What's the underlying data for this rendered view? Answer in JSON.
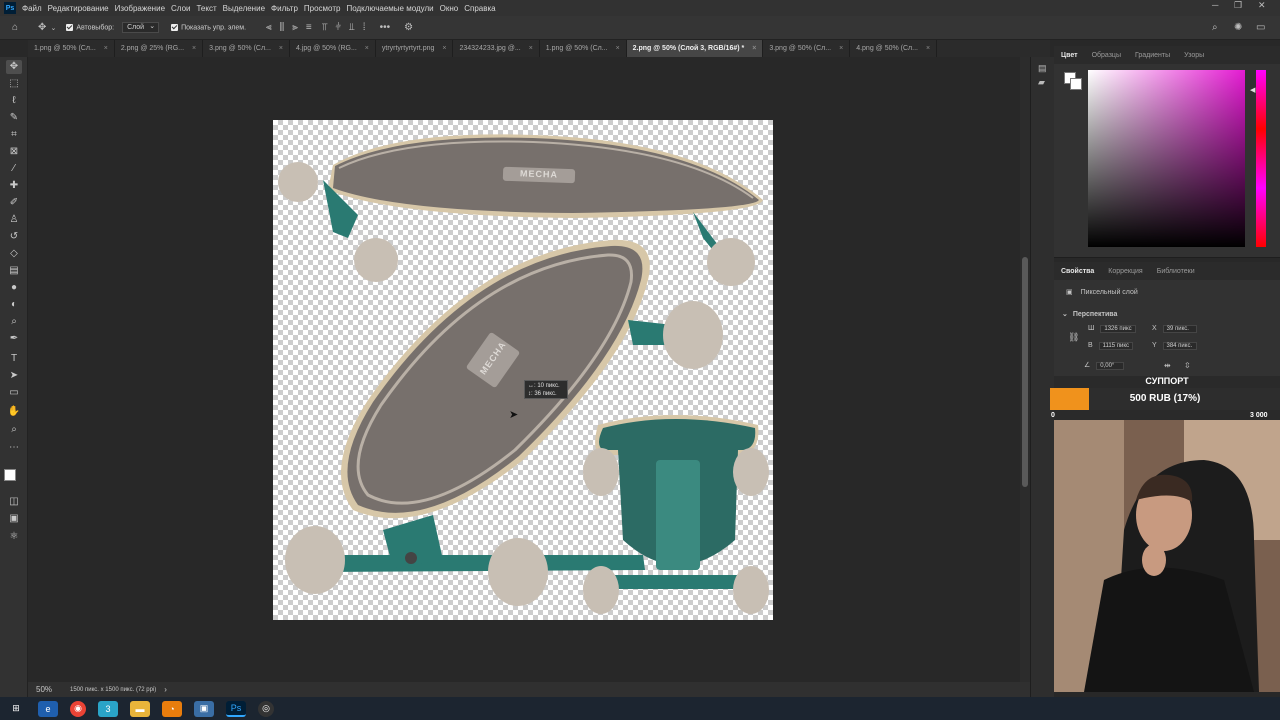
{
  "app": {
    "menu": [
      "Файл",
      "Редактирование",
      "Изображение",
      "Слои",
      "Текст",
      "Выделение",
      "Фильтр",
      "Просмотр",
      "Подключаемые модули",
      "Окно",
      "Справка"
    ],
    "logo": "Ps"
  },
  "options": {
    "autoselect_label": "Автовыбор:",
    "autoselect_value": "Слой",
    "show_controls_label": "Показать упр. элем."
  },
  "tabs": [
    {
      "label": "1.png @ 50% (Сл...",
      "active": false
    },
    {
      "label": "2.png @ 25% (RG...",
      "active": false
    },
    {
      "label": "3.png @ 50% (Сл...",
      "active": false
    },
    {
      "label": "4.jpg @ 50% (RG...",
      "active": false
    },
    {
      "label": "ytryrtyrtyrtyrt.png",
      "active": false
    },
    {
      "label": "234324233.jpg @...",
      "active": false
    },
    {
      "label": "1.png @ 50% (Сл...",
      "active": false
    },
    {
      "label": "2.png @ 50% (Слой 3, RGB/16#) *",
      "active": true
    },
    {
      "label": "3.png @ 50% (Сл...",
      "active": false
    },
    {
      "label": "4.png @ 50% (Сл...",
      "active": false
    }
  ],
  "canvas": {
    "logo_text": "MECHA",
    "tooltip_line1": "↔: 10 пикс.",
    "tooltip_line2": "↕: 36 пикс."
  },
  "status": {
    "zoom": "50%",
    "doc_info": "1500 пикс. x 1500 пикс. (72 ppi)"
  },
  "color_panel": {
    "tabs": [
      "Цвет",
      "Образцы",
      "Градиенты",
      "Узоры"
    ],
    "accent": "#e41bd2"
  },
  "properties": {
    "tabs": [
      "Свойства",
      "Коррекция",
      "Библиотеки"
    ],
    "layer_type": "Пиксельный слой",
    "section": "Перспектива",
    "w_label": "Ш",
    "w_value": "1326 пикс",
    "x_label": "X",
    "x_value": "39 пикс.",
    "h_label": "В",
    "h_value": "1115 пикс",
    "y_label": "Y",
    "y_value": "384 пикс.",
    "angle_value": "0,00°"
  },
  "donation": {
    "title": "СУППОРТ",
    "label": "500 RUB (17%)",
    "progress": 0.17,
    "min": "0",
    "max": "3 000",
    "color": "#f0921c"
  }
}
